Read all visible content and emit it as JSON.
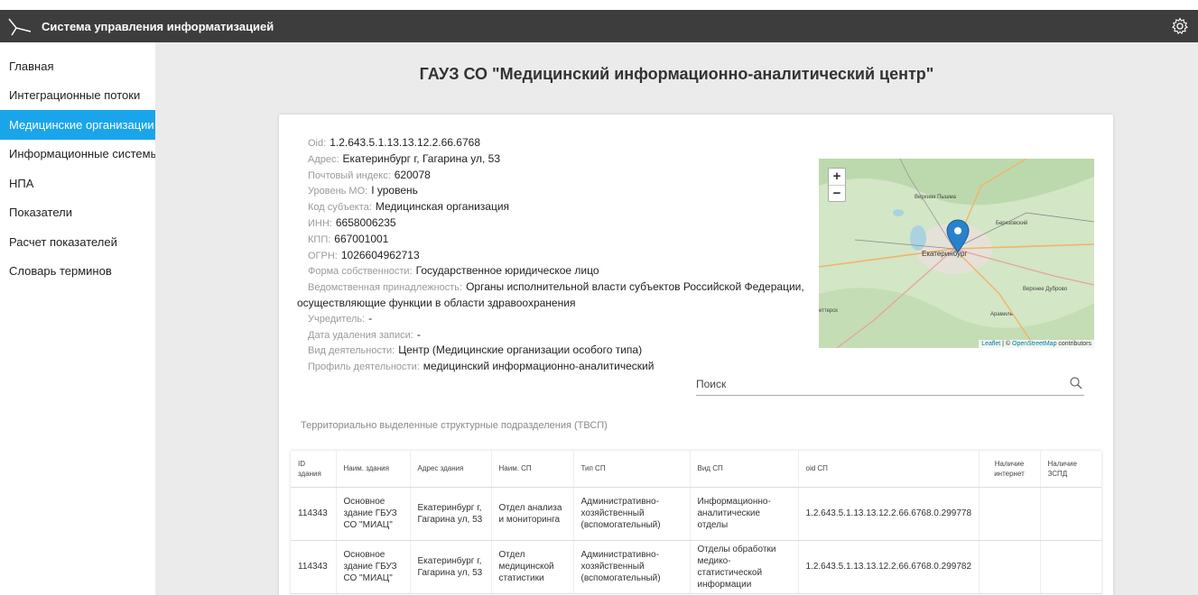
{
  "header": {
    "app_title": "Система управления информатизацией",
    "logo_icon": "branch-logo-icon",
    "settings_icon": "gear-icon"
  },
  "sidebar": {
    "items": [
      {
        "label": "Главная",
        "active": false
      },
      {
        "label": "Интеграционные потоки",
        "active": false
      },
      {
        "label": "Медицинские организации",
        "active": true
      },
      {
        "label": "Информационные системы",
        "active": false
      },
      {
        "label": "НПА",
        "active": false
      },
      {
        "label": "Показатели",
        "active": false
      },
      {
        "label": "Расчет показателей",
        "active": false
      },
      {
        "label": "Словарь терминов",
        "active": false
      }
    ]
  },
  "page": {
    "title": "ГАУЗ СО \"Медицинский информационно-аналитический центр\""
  },
  "info": {
    "oid": {
      "label": "Oid:",
      "value": "1.2.643.5.1.13.13.12.2.66.6768"
    },
    "address": {
      "label": "Адрес:",
      "value": "Екатеринбург г, Гагарина ул, 53"
    },
    "postcode": {
      "label": "Почтовый индекс:",
      "value": "620078"
    },
    "level": {
      "label": "Уровень МО:",
      "value": "I уровень"
    },
    "subject_code": {
      "label": "Код субъекта:",
      "value": "Медицинская организация"
    },
    "inn": {
      "label": "ИНН:",
      "value": "6658006235"
    },
    "kpp": {
      "label": "КПП:",
      "value": "667001001"
    },
    "ogrn": {
      "label": "ОГРН:",
      "value": "1026604962713"
    },
    "ownership": {
      "label": "Форма собственности:",
      "value": "Государственное юридическое лицо"
    },
    "affiliation": {
      "label": "Ведомственная принадлежность:",
      "value": "Органы исполнительной власти субъектов Российской Федерации, осуществляющие функции в области здравоохранения"
    },
    "founder": {
      "label": "Учредитель:",
      "value": "-"
    },
    "deleted_date": {
      "label": "Дата удаления записи:",
      "value": "-"
    },
    "activity_type": {
      "label": "Вид деятельности:",
      "value": "Центр (Медицинские организации особого типа)"
    },
    "activity_profile": {
      "label": "Профиль деятельности:",
      "value": "медицинский информационно-аналитический"
    }
  },
  "map": {
    "zoom_in": "+",
    "zoom_out": "−",
    "labels": {
      "city": "Екатеринбург",
      "north": "Верхняя Пышма",
      "northeast": "Березовский",
      "east": "Верхнее Дуброво",
      "southeast": "Арамиль",
      "west": "еттерск"
    },
    "attribution_leaflet": "Leaflet",
    "attribution_sep": " | © ",
    "attribution_osm": "OpenStreetMap",
    "attribution_rest": " contributors",
    "marker_icon": "map-marker-icon"
  },
  "search": {
    "placeholder": "Поиск",
    "icon": "search-icon"
  },
  "section": {
    "title": "Территориально выделенные структурные подразделения (ТВСП)"
  },
  "table": {
    "headers": [
      "ID здания",
      "Наим. здания",
      "Адрес здания",
      "Наим. СП",
      "Тип СП",
      "Вид СП",
      "oid СП",
      "Наличие интернет",
      "Наличие ЗСПД"
    ],
    "rows": [
      [
        "114343",
        "Основное здание ГБУЗ СО \"МИАЦ\"",
        "Екатеринбург г, Гагарина ул, 53",
        "Отдел анализа и мониторинга",
        "Административно-хозяйственный (вспомогательный)",
        "Информационно-аналитические отделы",
        "1.2.643.5.1.13.13.12.2.66.6768.0.299778",
        "",
        ""
      ],
      [
        "114343",
        "Основное здание ГБУЗ СО \"МИАЦ\"",
        "Екатеринбург г, Гагарина ул, 53",
        "Отдел медицинской статистики",
        "Административно-хозяйственный (вспомогательный)",
        "Отделы обработки медико-статистической информации",
        "1.2.643.5.1.13.13.12.2.66.6768.0.299782",
        "",
        ""
      ]
    ]
  },
  "colors": {
    "topbar": "#3d3d3d",
    "active_nav": "#1aa5ea",
    "main_bg": "#ebebeb",
    "marker": "#2a81cb"
  }
}
